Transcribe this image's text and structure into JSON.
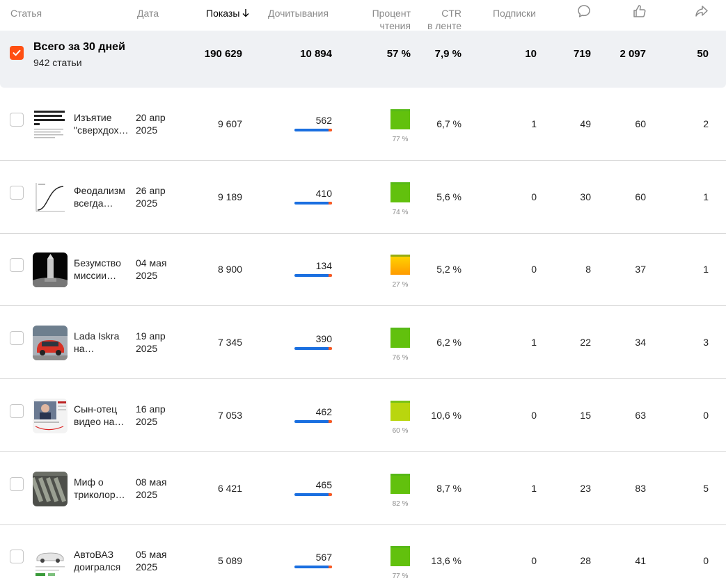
{
  "header": {
    "col_article": "Статья",
    "col_date": "Дата",
    "col_views": "Показы",
    "col_reads": "Дочитывания",
    "col_percent_1": "Процент",
    "col_percent_2": "чтения",
    "col_ctr_1": "CTR",
    "col_ctr_2": "в ленте",
    "col_subs": "Подписки",
    "sort_icon": "arrow-down-icon",
    "comments_icon": "comment-icon",
    "likes_icon": "thumbs-up-icon",
    "shares_icon": "share-icon"
  },
  "total": {
    "title": "Всего за 30 дней",
    "subtitle": "942 статьи",
    "views": "190 629",
    "reads": "10 894",
    "percent": "57 %",
    "ctr": "7,9 %",
    "subs": "10",
    "comments": "719",
    "likes": "2 097",
    "shares": "50"
  },
  "colors": {
    "accent": "#ff4f12",
    "bar": "#1a6fe0",
    "bar_tip": "#ff5a1f"
  },
  "rows": [
    {
      "title_1": "Изъятие",
      "title_2": "\"сверхдох…",
      "date_1": "20 апр",
      "date_2": "2025",
      "views": "9 607",
      "reads": "562",
      "percent_label": "77 %",
      "percent": 77,
      "ctr": "6,7 %",
      "subs": "1",
      "comments": "49",
      "likes": "60",
      "shares": "2"
    },
    {
      "title_1": "Феодализм",
      "title_2": "всегда…",
      "date_1": "26 апр",
      "date_2": "2025",
      "views": "9 189",
      "reads": "410",
      "percent_label": "74 %",
      "percent": 74,
      "ctr": "5,6 %",
      "subs": "0",
      "comments": "30",
      "likes": "60",
      "shares": "1"
    },
    {
      "title_1": "Безумство",
      "title_2": "миссии…",
      "date_1": "04 мая",
      "date_2": "2025",
      "views": "8 900",
      "reads": "134",
      "percent_label": "27 %",
      "percent": 27,
      "ctr": "5,2 %",
      "subs": "0",
      "comments": "8",
      "likes": "37",
      "shares": "1"
    },
    {
      "title_1": "Lada Iskra",
      "title_2": "на…",
      "date_1": "19 апр",
      "date_2": "2025",
      "views": "7 345",
      "reads": "390",
      "percent_label": "76 %",
      "percent": 76,
      "ctr": "6,2 %",
      "subs": "1",
      "comments": "22",
      "likes": "34",
      "shares": "3"
    },
    {
      "title_1": "Сын-отец",
      "title_2": "видео на…",
      "date_1": "16 апр",
      "date_2": "2025",
      "views": "7 053",
      "reads": "462",
      "percent_label": "60 %",
      "percent": 60,
      "ctr": "10,6 %",
      "subs": "0",
      "comments": "15",
      "likes": "63",
      "shares": "0"
    },
    {
      "title_1": "Миф о",
      "title_2": "триколор…",
      "date_1": "08 мая",
      "date_2": "2025",
      "views": "6 421",
      "reads": "465",
      "percent_label": "82 %",
      "percent": 82,
      "ctr": "8,7 %",
      "subs": "1",
      "comments": "23",
      "likes": "83",
      "shares": "5"
    },
    {
      "title_1": "АвтоВАЗ",
      "title_2": "доигрался",
      "date_1": "05 мая",
      "date_2": "2025",
      "views": "5 089",
      "reads": "567",
      "percent_label": "77 %",
      "percent": 77,
      "ctr": "13,6 %",
      "subs": "0",
      "comments": "28",
      "likes": "41",
      "shares": "0"
    }
  ]
}
